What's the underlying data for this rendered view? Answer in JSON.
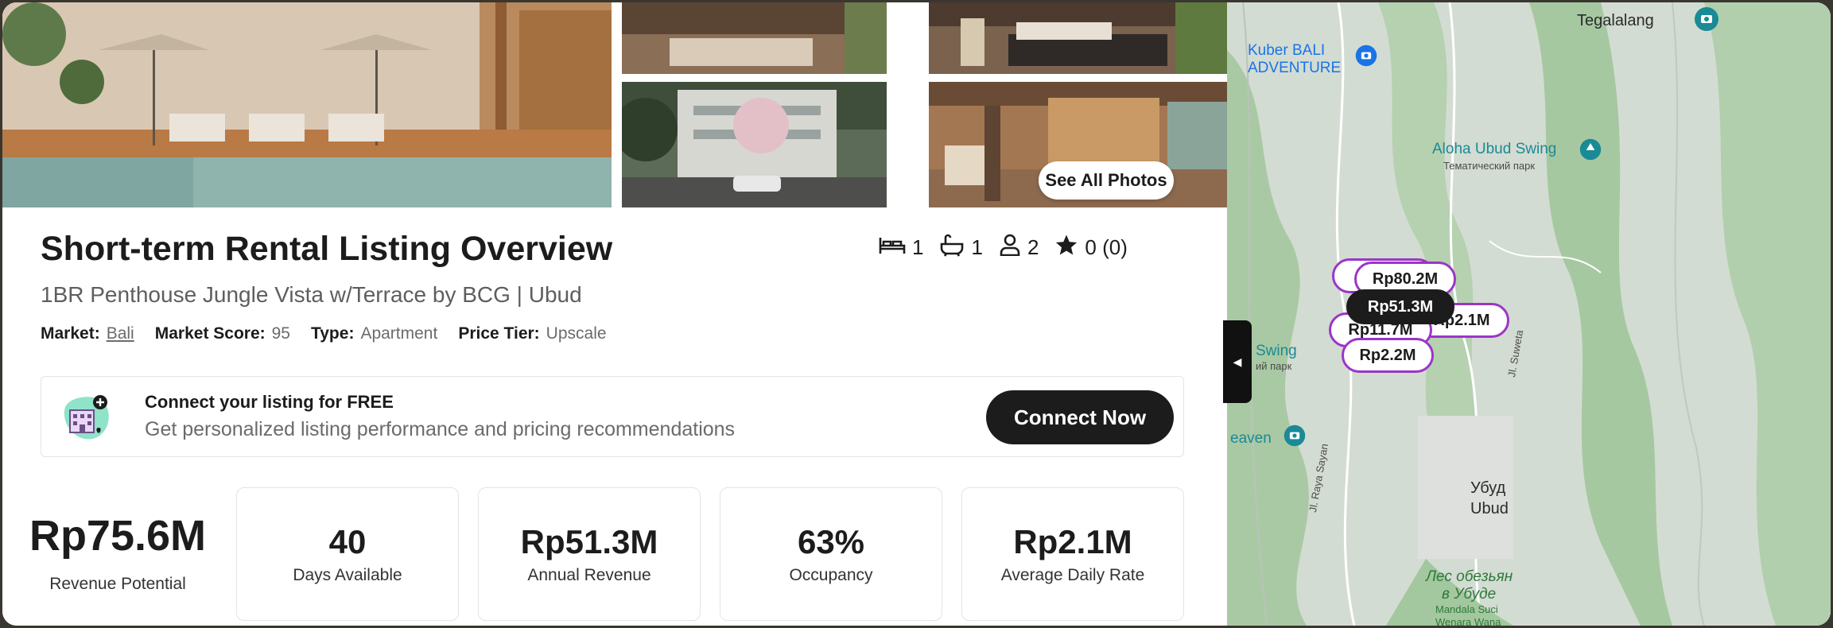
{
  "gallery": {
    "see_all_label": "See All Photos"
  },
  "listing": {
    "title": "Short-term Rental Listing Overview",
    "subtitle": "1BR Penthouse Jungle Vista w/Terrace by BCG | Ubud",
    "meta": {
      "market_label": "Market:",
      "market_value": "Bali",
      "score_label": "Market Score:",
      "score_value": "95",
      "type_label": "Type:",
      "type_value": "Apartment",
      "tier_label": "Price Tier:",
      "tier_value": "Upscale"
    },
    "stats": {
      "bedrooms": "1",
      "bathrooms": "1",
      "guests": "2",
      "rating": "0 (0)"
    }
  },
  "banner": {
    "title": "Connect your listing for FREE",
    "subtitle": "Get personalized listing performance and pricing recommendations",
    "button_label": "Connect Now"
  },
  "kpis": {
    "main": {
      "value": "Rp75.6M",
      "label": "Revenue Potential"
    },
    "items": [
      {
        "value": "40",
        "label": "Days Available"
      },
      {
        "value": "Rp51.3M",
        "label": "Annual Revenue"
      },
      {
        "value": "63%",
        "label": "Occupancy"
      },
      {
        "value": "Rp2.1M",
        "label": "Average Daily Rate"
      }
    ]
  },
  "map": {
    "labels": {
      "tegalalang": "Tegalalang",
      "kuber_line1": "Kuber BALI",
      "kuber_line2": "ADVENTURE",
      "aloha": "Aloha Ubud Swing",
      "aloha_sub": "Тематический парк",
      "swing": "Swing",
      "swing_sub": "ий парк",
      "heaven": "eaven",
      "ubud_ru": "Убуд",
      "ubud": "Ubud",
      "forest_ru1": "Лес обезьян",
      "forest_ru2": "в Убуде",
      "mandala1": "Mandala Suci",
      "mandala2": "Wenara Wana",
      "road1": "Jl. Raya Sayan",
      "road2": "Jl. Suweta"
    },
    "pins": {
      "active": "Rp51.3M",
      "top": "Rp80.2M",
      "left": "Rp11.7M",
      "right": "Rp2.1M",
      "bottom": "Rp2.2M"
    },
    "colors": {
      "pin_border": "#9b35c9",
      "active_pin": "#1c1c1c"
    }
  }
}
